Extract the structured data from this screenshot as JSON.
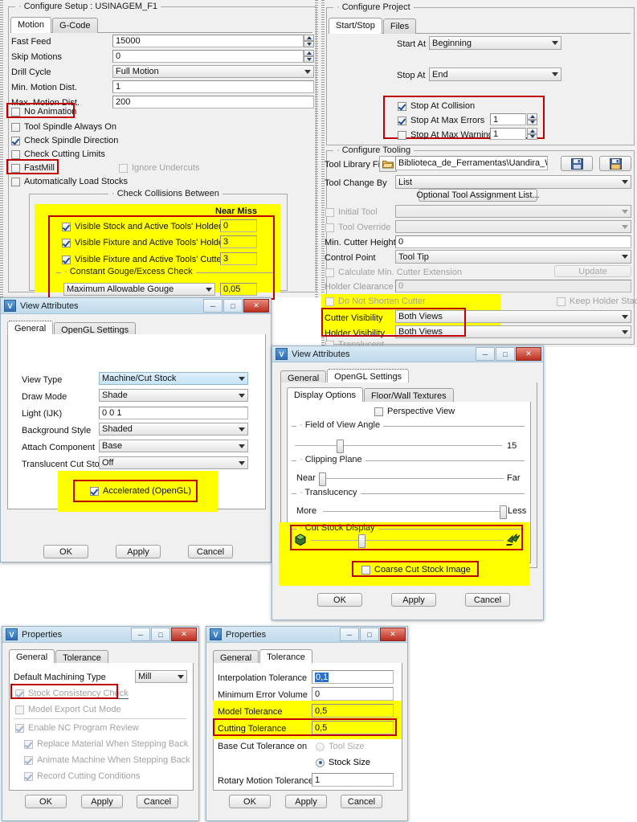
{
  "configure_setup": {
    "group_title": "Configure Setup : USINAGEM_F1",
    "tabs": [
      {
        "label": "Motion",
        "active": true
      },
      {
        "label": "G-Code",
        "active": false
      }
    ],
    "fields": [
      {
        "label": "Fast Feed",
        "value": "15000",
        "type": "spinner"
      },
      {
        "label": "Skip Motions",
        "value": "0",
        "type": "spinner"
      },
      {
        "label": "Drill Cycle",
        "value": "Full Motion",
        "type": "combo"
      },
      {
        "label": "Min. Motion Dist.",
        "value": "1",
        "type": "text"
      },
      {
        "label": "Max. Motion Dist.",
        "value": "200",
        "type": "text"
      }
    ],
    "checkboxes": [
      {
        "label": "No Animation",
        "checked": false,
        "highlight": "red"
      },
      {
        "label": "Tool Spindle Always On",
        "checked": false
      },
      {
        "label": "Check Spindle Direction",
        "checked": true
      },
      {
        "label": "Check Cutting Limits",
        "checked": false
      },
      {
        "label": "FastMill",
        "checked": false,
        "highlight": "red"
      },
      {
        "label": "Automatically Load Stocks",
        "checked": false
      }
    ],
    "ignore_undercuts": {
      "label": "Ignore Undercuts",
      "checked": false,
      "disabled": true
    },
    "collisions": {
      "group_title": "Check Collisions Between",
      "near_miss_header": "Near Miss",
      "rows": [
        {
          "label": "Visible Stock and Active Tools' Holders",
          "checked": true,
          "near_miss": "0"
        },
        {
          "label": "Visible Fixture and Active Tools' Holders",
          "checked": true,
          "near_miss": "3"
        },
        {
          "label": "Visible Fixture and Active Tools' Cutters",
          "checked": true,
          "near_miss": "3"
        }
      ],
      "gouge_group_title": "Constant Gouge/Excess Check",
      "gouge_mode": "Maximum Allowable Gouge",
      "gouge_value": "0,05"
    }
  },
  "configure_project": {
    "group_title": "Configure Project",
    "tabs": [
      {
        "label": "Start/Stop",
        "active": true
      },
      {
        "label": "Files",
        "active": false
      }
    ],
    "start_at_label": "Start At",
    "start_at_value": "Beginning",
    "stop_at_label": "Stop At",
    "stop_at_value": "End",
    "stop_options": [
      {
        "label": "Stop At Collision",
        "checked": true,
        "value": null
      },
      {
        "label": "Stop At Max Errors",
        "checked": true,
        "value": "1"
      },
      {
        "label": "Stop At Max Warnings",
        "checked": false,
        "value": "1"
      }
    ]
  },
  "configure_tooling": {
    "group_title": "Configure Tooling",
    "tool_library_label": "Tool Library File",
    "tool_library_value": "Biblioteca_de_Ferramentas\\Uandira_WFL.tls",
    "open_icon": "folder-open-icon",
    "save_icon": "save-icon",
    "save_as_icon": "save-as-icon",
    "tool_change_by_label": "Tool Change By",
    "tool_change_by_value": "List",
    "optional_list_button": "Optional Tool Assignment List...",
    "initial_tool": {
      "label": "Initial Tool",
      "checked": false,
      "value": ""
    },
    "tool_override": {
      "label": "Tool Override",
      "checked": false,
      "value": ""
    },
    "min_cutter_height_label": "Min. Cutter Height",
    "min_cutter_height_value": "0",
    "control_point_label": "Control Point",
    "control_point_value": "Tool Tip",
    "calculate_min_ext": {
      "label": "Calculate Min. Cutter Extension",
      "checked": false
    },
    "update_button": "Update",
    "holder_clearance_label": "Holder Clearance",
    "holder_clearance_value": "0",
    "do_not_shorten": {
      "label": "Do Not Shorten Cutter",
      "checked": false
    },
    "keep_holder_stack": {
      "label": "Keep Holder Stack",
      "checked": false
    },
    "cutter_visibility_label": "Cutter Visibility",
    "cutter_visibility_value": "Both Views",
    "holder_visibility_label": "Holder Visibility",
    "holder_visibility_value": "Both Views",
    "translucent": {
      "label": "Translucent",
      "checked": false
    }
  },
  "view_attributes_general": {
    "title": "View Attributes",
    "window_icon": "vericut-logo-icon",
    "minimize_icon": "minimize-icon",
    "maximize_icon": "maximize-icon",
    "close_icon": "close-icon",
    "tabs": [
      {
        "label": "General",
        "active": true
      },
      {
        "label": "OpenGL Settings",
        "active": false
      }
    ],
    "rows": [
      {
        "label": "View Type",
        "value": "Machine/Cut Stock",
        "selected": true
      },
      {
        "label": "Draw Mode",
        "value": "Shade",
        "selected": false
      },
      {
        "label": "Light (IJK)",
        "value": "0 0 1",
        "type": "text"
      },
      {
        "label": "Background Style",
        "value": "Shaded",
        "selected": false
      },
      {
        "label": "Attach Component",
        "value": "Base",
        "selected": false
      },
      {
        "label": "Translucent Cut Stock",
        "value": "Off",
        "selected": false
      }
    ],
    "accelerated": {
      "label": "Accelerated (OpenGL)",
      "checked": true
    },
    "buttons": [
      "OK",
      "Apply",
      "Cancel"
    ]
  },
  "view_attributes_opengl": {
    "title": "View Attributes",
    "window_icon": "vericut-logo-icon",
    "minimize_icon": "minimize-icon",
    "maximize_icon": "maximize-icon",
    "close_icon": "close-icon",
    "tabs": [
      {
        "label": "General",
        "active": false
      },
      {
        "label": "OpenGL Settings",
        "active": true
      }
    ],
    "subtabs": [
      {
        "label": "Display Options",
        "active": true
      },
      {
        "label": "Floor/Wall Textures",
        "active": false
      }
    ],
    "perspective_view": {
      "label": "Perspective View",
      "checked": false
    },
    "fov_group": "Field of View Angle",
    "fov_value": "15",
    "clipping_group": "Clipping Plane",
    "clipping_near": "Near",
    "clipping_far": "Far",
    "translucency_group": "Translucency",
    "translucency_more": "More",
    "translucency_less": "Less",
    "cut_stock_group": "Cut Stock Display",
    "cut_stock_left_icon": "solid-stock-icon",
    "cut_stock_right_icon": "fast-stock-icon",
    "coarse_cut_stock": {
      "label": "Coarse Cut Stock Image",
      "checked": false
    },
    "buttons": [
      "OK",
      "Apply",
      "Cancel"
    ]
  },
  "properties_general": {
    "title": "Properties",
    "window_icon": "vericut-logo-icon",
    "minimize_icon": "minimize-icon",
    "maximize_icon": "maximize-icon",
    "close_icon": "close-icon",
    "tabs": [
      {
        "label": "General",
        "active": true
      },
      {
        "label": "Tolerance",
        "active": false
      }
    ],
    "default_machining_label": "Default Machining Type",
    "default_machining_value": "Mill",
    "checkboxes": [
      {
        "label": "Stock Consistency Check",
        "checked": true,
        "disabled": true,
        "highlight": "red"
      },
      {
        "label": "Model Export Cut Mode",
        "checked": false,
        "disabled": true
      },
      {
        "label": "Enable NC Program Review",
        "checked": true,
        "disabled": true
      },
      {
        "label": "Replace Material When Stepping Back",
        "checked": true,
        "disabled": true,
        "indent": true
      },
      {
        "label": "Animate Machine When Stepping Back",
        "checked": true,
        "disabled": true,
        "indent": true
      },
      {
        "label": "Record Cutting Conditions",
        "checked": true,
        "disabled": true,
        "indent": true
      }
    ],
    "buttons": [
      "OK",
      "Apply",
      "Cancel"
    ]
  },
  "properties_tolerance": {
    "title": "Properties",
    "window_icon": "vericut-logo-icon",
    "minimize_icon": "minimize-icon",
    "maximize_icon": "maximize-icon",
    "close_icon": "close-icon",
    "tabs": [
      {
        "label": "General",
        "active": false
      },
      {
        "label": "Tolerance",
        "active": true
      }
    ],
    "rows": [
      {
        "label": "Interpolation Tolerance",
        "value": "0,1",
        "text_selected": true
      },
      {
        "label": "Minimum Error Volume",
        "value": "0"
      },
      {
        "label": "Model Tolerance",
        "value": "0,5",
        "highlight": "yellow"
      },
      {
        "label": "Cutting Tolerance",
        "value": "0,5",
        "highlight": "yellow-red"
      }
    ],
    "base_cut_label": "Base Cut Tolerance on",
    "base_cut_options": [
      {
        "label": "Tool Size",
        "selected": false,
        "disabled": true
      },
      {
        "label": "Stock Size",
        "selected": true
      }
    ],
    "rotary_label": "Rotary Motion Tolerance",
    "rotary_value": "1",
    "buttons": [
      "OK",
      "Apply",
      "Cancel"
    ]
  },
  "colors": {
    "highlight_yellow": "#ffff00",
    "highlight_red": "#c00000",
    "accent_blue": "#2f6fb5",
    "panel_gray": "#f0f0f0"
  }
}
